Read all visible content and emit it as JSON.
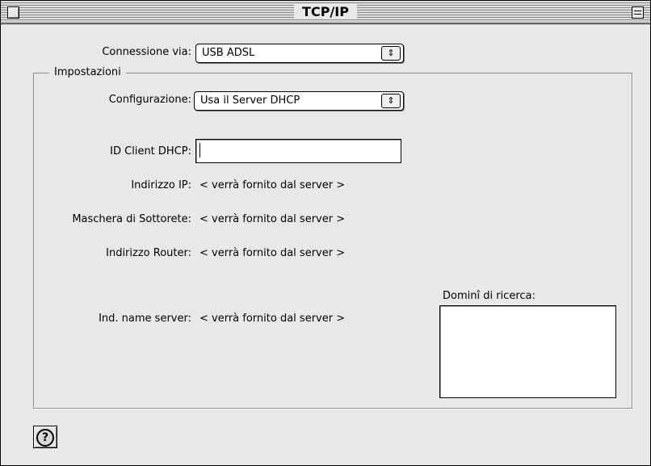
{
  "window": {
    "title": "TCP/IP"
  },
  "connection": {
    "label": "Connessione via:",
    "value": "USB ADSL"
  },
  "settings": {
    "group_title": "Impostazioni",
    "configuration": {
      "label": "Configurazione:",
      "value": "Usa il Server DHCP"
    },
    "dhcp_client_id": {
      "label": "ID Client DHCP:",
      "value": ""
    },
    "ip_address": {
      "label": "Indirizzo IP:",
      "value": "< verrà fornito dal server >"
    },
    "subnet_mask": {
      "label": "Maschera di Sottorete:",
      "value": "< verrà fornito dal server >"
    },
    "router_address": {
      "label": "Indirizzo Router:",
      "value": "< verrà fornito dal server >"
    },
    "name_server": {
      "label": "Ind. name server:",
      "value": "< verrà fornito dal server >"
    },
    "search_domains": {
      "label": "Dominî di ricerca:",
      "value": ""
    }
  },
  "icons": {
    "popup_arrow": "⇕",
    "help": "?"
  }
}
